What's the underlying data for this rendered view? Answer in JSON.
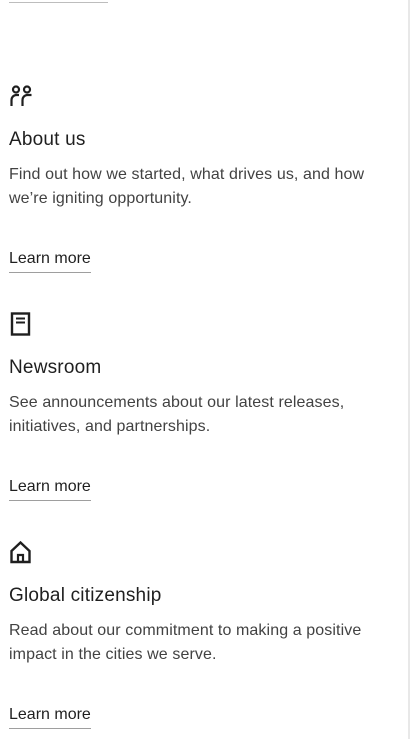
{
  "sections": [
    {
      "icon": "people-icon",
      "title": "About us",
      "description": "Find out how we started, what drives us, and how we’re igniting opportunity.",
      "link_label": "Learn more"
    },
    {
      "icon": "document-icon",
      "title": "Newsroom",
      "description": "See announcements about our latest releases, initiatives, and partnerships.",
      "link_label": "Learn more"
    },
    {
      "icon": "home-icon",
      "title": "Global citizenship",
      "description": "Read about our commitment to making a positive impact in the cities we serve.",
      "link_label": "Learn more"
    }
  ],
  "colors": {
    "text": "#1f1f1f",
    "body_text": "#424242",
    "underline": "#9e9e9e",
    "background": "#ffffff"
  }
}
